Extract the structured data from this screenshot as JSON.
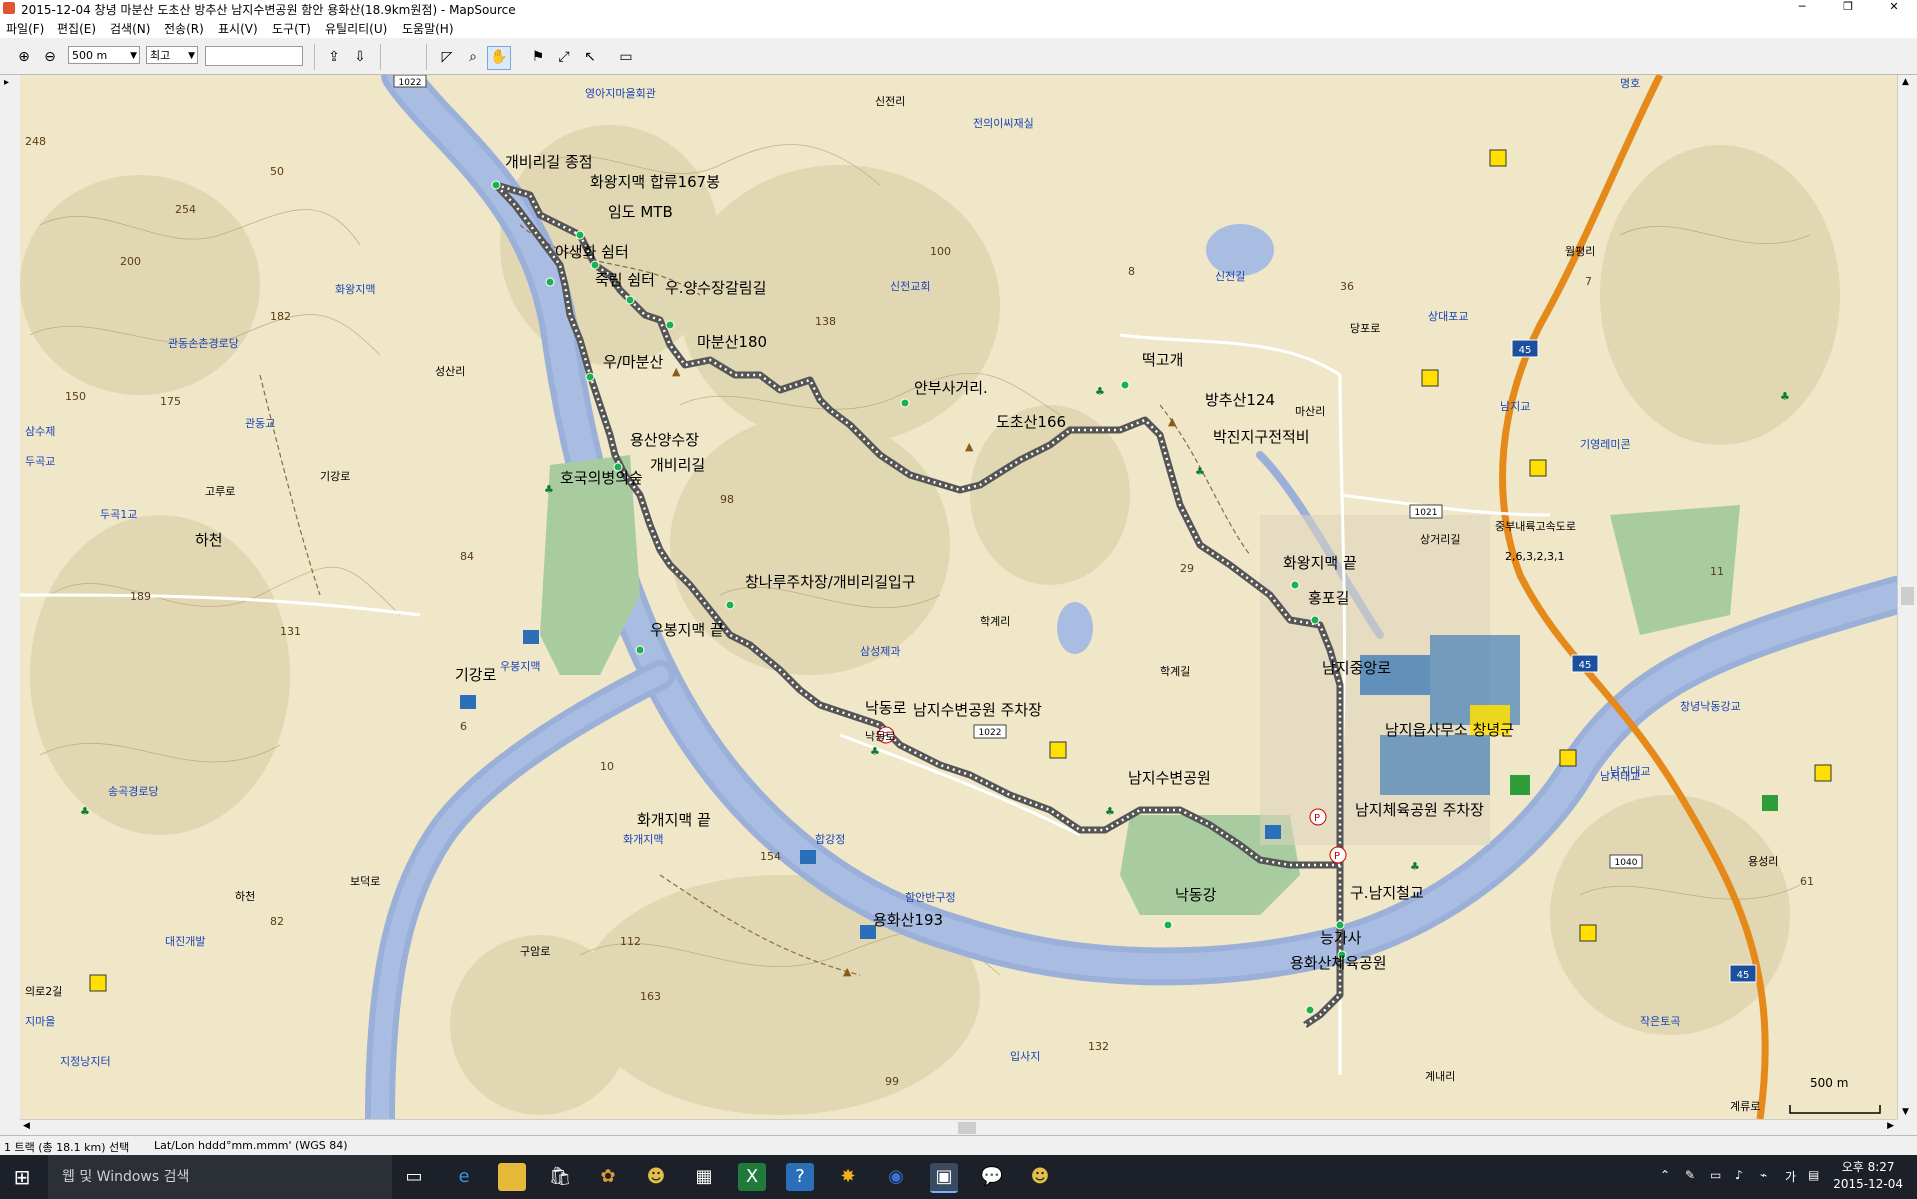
{
  "window": {
    "title": "2015-12-04 창녕 마분산 도초산 방추산 남지수변공원 함안 용화산(18.9km원점) - MapSource",
    "minimize": "─",
    "restore": "❐",
    "close": "✕"
  },
  "menu": [
    "파일(F)",
    "편집(E)",
    "검색(N)",
    "전송(R)",
    "표시(V)",
    "도구(T)",
    "유틸리티(U)",
    "도움말(H)"
  ],
  "toolbar": {
    "zoom_value": "500 m",
    "detail_value": "최고"
  },
  "map": {
    "scale_label": "500 m",
    "waypoints": [
      "개비리길 종점",
      "화왕지맥 합류167봉",
      "임도 MTB",
      "야생화 쉼터",
      "죽림 쉼터",
      "우.양수장갈림길",
      "우/마분산",
      "마분산180",
      "안부사거리.",
      "도초산166",
      "떡고개",
      "방추산124",
      "박진지구전적비",
      "용산양수장",
      "호국의병의숲",
      "개비리길",
      "창나루주차장/개비리길입구",
      "우봉지맥 끝",
      "남지수변공원 주차장",
      "남지수변공원",
      "화왕지맥 끝",
      "홍포길",
      "남지중앙로",
      "남지읍사무소 창녕군",
      "남지체육공원 주차장",
      "구.남지철교",
      "능가사",
      "용화산체육공원",
      "화개지맥 끝",
      "용화산193",
      "낙동강",
      "하천",
      "기강로",
      "낙동로",
      "남지"
    ],
    "places": [
      "영아지마을회관",
      "신전리",
      "전의이씨재실",
      "화왕지맥",
      "성산리",
      "관동교",
      "관동손촌경로당",
      "삼수제",
      "두곡교",
      "두곡1교",
      "고루로",
      "기강로",
      "하천",
      "우봉지맥",
      "송곡경로당",
      "대진개발",
      "의로2길",
      "지마을",
      "지정낭지터",
      "보덕로",
      "화개지맥",
      "구암로",
      "함안반구정",
      "합강정",
      "입사지",
      "신전길",
      "신전교회",
      "당포로",
      "상대포교",
      "남지교",
      "기영레미콘",
      "중부내륙고속도로",
      "상거리길",
      "학계리",
      "학계길",
      "삼성제과",
      "월평리",
      "명호",
      "남지태교",
      "창녕낙동강교",
      "계내리",
      "계류로",
      "용성리",
      "작은토곡",
      "2,6,3,2,3,1",
      "마산리",
      "낙동로",
      "남지대교"
    ],
    "road_numbers": [
      "1022",
      "1021",
      "45",
      "45",
      "45",
      "1040"
    ],
    "numbers": [
      "248",
      "254",
      "200",
      "182",
      "150",
      "175",
      "189",
      "84",
      "131",
      "50",
      "100",
      "138",
      "98",
      "29",
      "36",
      "10",
      "154",
      "112",
      "163",
      "132",
      "99",
      "82",
      "61",
      "11",
      "6",
      "7",
      "8"
    ]
  },
  "status": {
    "track": "1 트랙 (총 18.1 km) 선택",
    "position": "Lat/Lon hddd°mm.mmm' (WGS 84)"
  },
  "taskbar": {
    "search_placeholder": "웹 및 Windows 검색",
    "time": "오후 8:27",
    "date": "2015-12-04",
    "ime": "가"
  }
}
